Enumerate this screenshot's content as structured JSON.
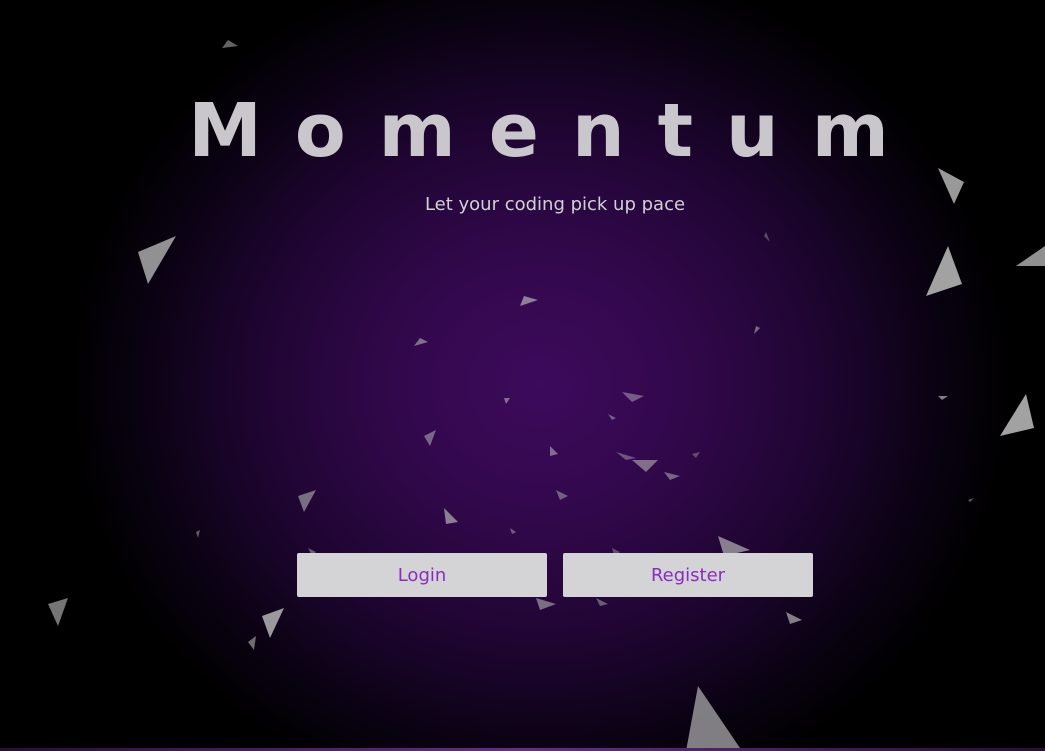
{
  "app": {
    "title": "Momentum",
    "tagline": "Let your coding pick up pace"
  },
  "actions": {
    "login_label": "Login",
    "register_label": "Register"
  },
  "theme": {
    "background_center": "#3d0a5c",
    "background_edge": "#000000",
    "title_color": "#c9c7cc",
    "button_bg": "#d4d3d6",
    "button_text": "#8a2cc0",
    "particle_color": "#b4b4b4"
  }
}
